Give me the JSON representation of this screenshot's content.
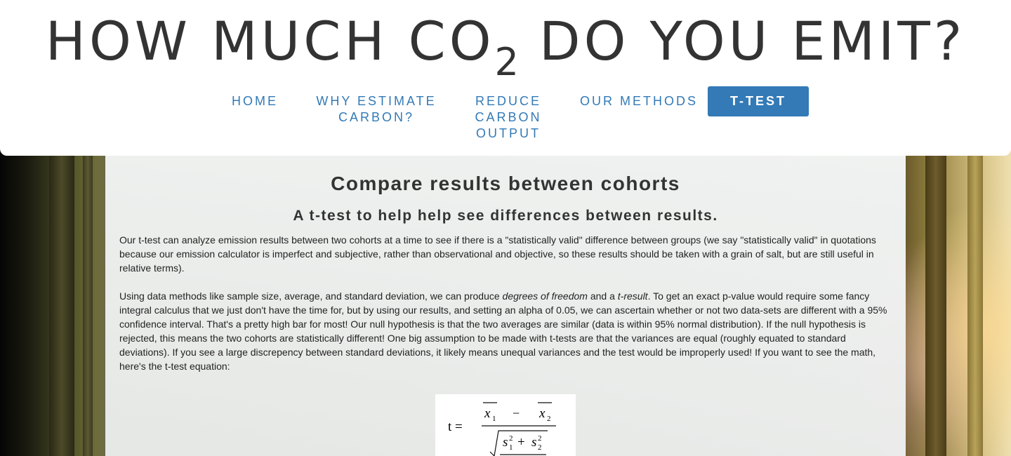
{
  "site": {
    "title_before": "HOW MUCH CO",
    "title_subscript": "2",
    "title_after": " DO YOU EMIT?"
  },
  "nav": {
    "items": [
      {
        "label": "HOME"
      },
      {
        "label": "WHY ESTIMATE CARBON?"
      },
      {
        "label": "REDUCE CARBON OUTPUT"
      },
      {
        "label": "OUR METHODS"
      },
      {
        "label": "T-TEST",
        "active": true
      }
    ]
  },
  "main": {
    "heading": "Compare results between cohorts",
    "subheading": "A t-test to help help see differences between results.",
    "paragraph1": "Our t-test can analyze emission results between two cohorts at a time to see if there is a \"statistically valid\" difference between groups (we say \"statistically valid\" in quotations because our emission calculator is imperfect and subjective, rather than observational and objective, so these results should be taken with a grain of salt, but are still useful in relative terms).",
    "paragraph2_a": "Using data methods like sample size, average, and standard deviation, we can produce ",
    "paragraph2_em1": "degrees of freedom",
    "paragraph2_b": " and a ",
    "paragraph2_em2": "t-result",
    "paragraph2_c": ". To get an exact p-value would require some fancy integral calculus that we just don't have the time for, but by using our results, and setting an alpha of 0.05, we can ascertain whether or not two data-sets are different with a 95% confidence interval. That's a pretty high bar for most! Our null hypothesis is that the two averages are similar (data is within 95% normal distribution). If the null hypothesis is rejected, this means the two cohorts are statistically different! One big assumption to be made with t-tests are that the variances are equal (roughly equated to standard deviations). If you see a large discrepency between standard deviations, it likely means unequal variances and the test would be improperly used! If you want to see the math, here's the t-test equation:"
  },
  "formula": {
    "lhs": "t =",
    "x1": "x",
    "x1_sub": "1",
    "minus": "−",
    "x2": "x",
    "x2_sub": "2",
    "s1": "s",
    "s1_sub": "1",
    "s1_sup": "2",
    "plus": "+",
    "s2": "s",
    "s2_sub": "2",
    "s2_sup": "2"
  }
}
